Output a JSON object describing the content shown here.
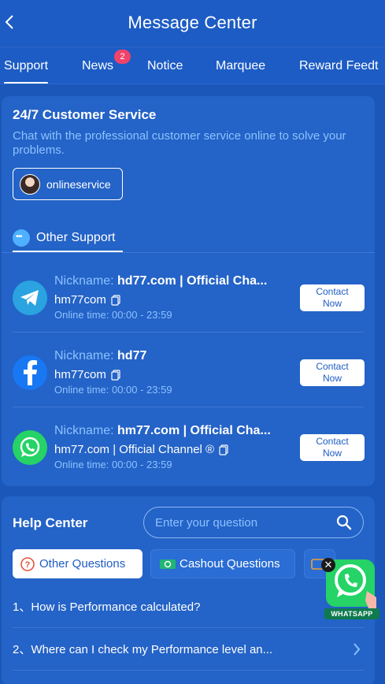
{
  "header": {
    "title": "Message Center"
  },
  "tabs": [
    {
      "label": "Support"
    },
    {
      "label": "News",
      "badge": "2"
    },
    {
      "label": "Notice"
    },
    {
      "label": "Marquee"
    },
    {
      "label": "Reward Feedt"
    }
  ],
  "customer_service": {
    "title": "24/7 Customer Service",
    "description": "Chat with the professional customer service online to solve your problems.",
    "online_button": "onlineservice"
  },
  "other_support": {
    "title": "Other Support",
    "contacts": [
      {
        "app": "telegram-icon",
        "nickname_label": "Nickname: ",
        "nickname": "hd77.com | Official Cha...",
        "account": "hm77com",
        "online_time": "Online time: 00:00 - 23:59",
        "button_line1": "Contact",
        "button_line2": "Now"
      },
      {
        "app": "facebook-icon",
        "nickname_label": "Nickname: ",
        "nickname": "hd77",
        "account": "hm77com",
        "online_time": "Online time: 00:00 - 23:59",
        "button_line1": "Contact",
        "button_line2": "Now"
      },
      {
        "app": "whatsapp-icon",
        "nickname_label": "Nickname: ",
        "nickname": "hm77.com | Official Cha...",
        "account": "hm77.com | Official Channel ®",
        "online_time": "Online time: 00:00 - 23:59",
        "button_line1": "Contact",
        "button_line2": "Now"
      }
    ]
  },
  "help_center": {
    "title": "Help Center",
    "search_placeholder": "Enter your question",
    "question_tabs": [
      {
        "label": "Other Questions",
        "icon": "question-circle-icon"
      },
      {
        "label": "Cashout Questions",
        "icon": "cash-icon"
      }
    ],
    "faqs": [
      {
        "text": "1、How is Performance calculated?"
      },
      {
        "text": "2、Where can I check my Performance level an..."
      }
    ]
  },
  "whatsapp_float": {
    "label": "WHATSAPP"
  },
  "colors": {
    "background": "#1b57b8",
    "header": "#1d5cc4",
    "card": "#2463c7",
    "accent_text": "#8cc2ff",
    "badge": "#f0436a",
    "whatsapp": "#25d366",
    "telegram": "#2aa3e0",
    "facebook": "#1877f2"
  }
}
